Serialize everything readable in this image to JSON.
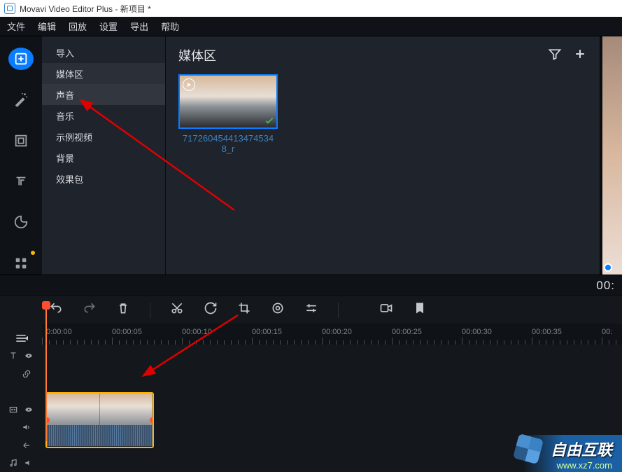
{
  "titlebar": {
    "text": "Movavi Video Editor Plus - 新项目 *"
  },
  "menubar": {
    "items": [
      "文件",
      "编辑",
      "回放",
      "设置",
      "导出",
      "帮助"
    ]
  },
  "navlist": {
    "items": [
      {
        "label": "导入",
        "state": ""
      },
      {
        "label": "媒体区",
        "state": "active"
      },
      {
        "label": "声音",
        "state": "hover"
      },
      {
        "label": "音乐",
        "state": ""
      },
      {
        "label": "示例视频",
        "state": ""
      },
      {
        "label": "背景",
        "state": ""
      },
      {
        "label": "效果包",
        "state": ""
      }
    ]
  },
  "mediapanel": {
    "title": "媒体区",
    "clip_name": "717260454413474534\n8_r"
  },
  "timecode": "00:",
  "ruler": {
    "ticks": [
      "0:00:00",
      "00:00:05",
      "00:00:10",
      "00:00:15",
      "00:00:20",
      "00:00:25",
      "00:00:30",
      "00:00:35",
      "00:"
    ]
  },
  "watermark": {
    "t1": "自由互联",
    "t2": "www.xz7.com"
  }
}
